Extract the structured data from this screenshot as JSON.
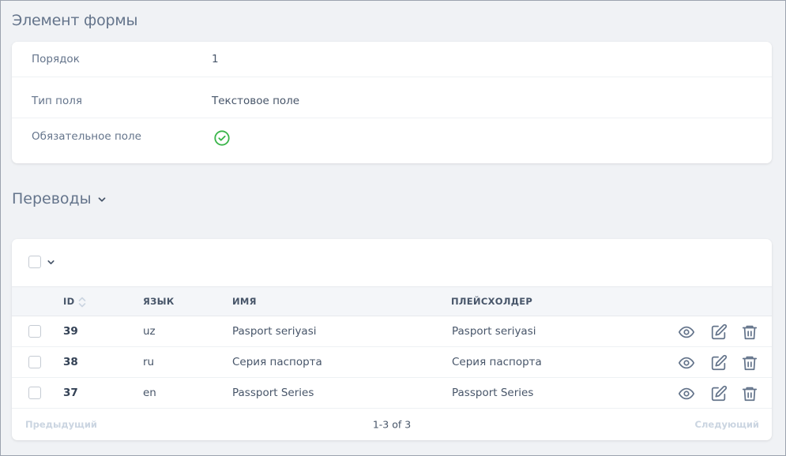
{
  "page": {
    "title": "Элемент формы"
  },
  "details": [
    {
      "label": "Порядок",
      "value": "1"
    },
    {
      "label": "Тип поля",
      "value": "Текстовое поле"
    },
    {
      "label": "Обязательное поле",
      "value": ""
    }
  ],
  "translations": {
    "title": "Переводы",
    "columns": {
      "id": "ID",
      "language": "ЯЗЫК",
      "name": "ИМЯ",
      "placeholder": "ПЛЕЙСХОЛДЕР"
    },
    "rows": [
      {
        "id": "39",
        "lang": "uz",
        "name": "Pasport seriyasi",
        "placeholder": "Pasport seriyasi"
      },
      {
        "id": "38",
        "lang": "ru",
        "name": "Серия паспорта",
        "placeholder": "Серия паспорта"
      },
      {
        "id": "37",
        "lang": "en",
        "name": "Passport Series",
        "placeholder": "Passport Series"
      }
    ],
    "pagination": {
      "prev": "Предыдущий",
      "info": "1-3 of 3",
      "next": "Следующий"
    }
  },
  "icons": {
    "required": "check-circle-icon",
    "collapse": "chevron-down-icon",
    "sort": "sort-icon",
    "view": "eye-icon",
    "edit": "edit-icon",
    "delete": "trash-icon"
  },
  "colors": {
    "success": "#3ab54a",
    "icon": "#64748b"
  }
}
